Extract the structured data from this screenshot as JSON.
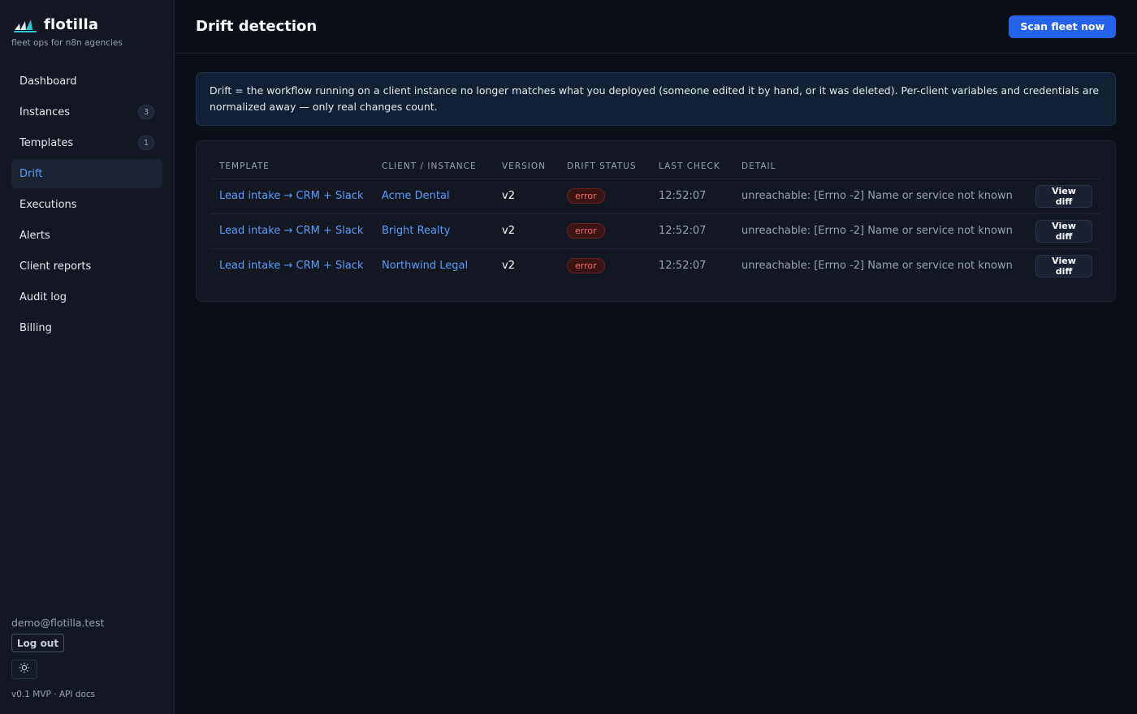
{
  "brand": {
    "name": "flotilla",
    "tagline": "fleet ops for n8n agencies",
    "logo_icon": "sailboats-logo-icon",
    "accent": "#2ec4d6"
  },
  "sidebar": {
    "items": [
      {
        "label": "Dashboard",
        "badge": null,
        "active": false
      },
      {
        "label": "Instances",
        "badge": "3",
        "active": false
      },
      {
        "label": "Templates",
        "badge": "1",
        "active": false
      },
      {
        "label": "Drift",
        "badge": null,
        "active": true
      },
      {
        "label": "Executions",
        "badge": null,
        "active": false
      },
      {
        "label": "Alerts",
        "badge": null,
        "active": false
      },
      {
        "label": "Client reports",
        "badge": null,
        "active": false
      },
      {
        "label": "Audit log",
        "badge": null,
        "active": false
      },
      {
        "label": "Billing",
        "badge": null,
        "active": false
      }
    ],
    "footer": {
      "email": "demo@flotilla.test",
      "logout_label": "Log out",
      "theme_icon": "sun-icon",
      "version": "v0.1 MVP",
      "separator": "·",
      "api_docs": "API docs"
    }
  },
  "header": {
    "title": "Drift detection",
    "scan_label": "Scan fleet now"
  },
  "info": {
    "text": "Drift = the workflow running on a client instance no longer matches what you deployed (someone edited it by hand, or it was deleted). Per-client variables and credentials are normalized away — only real changes count."
  },
  "table": {
    "columns": [
      "TEMPLATE",
      "CLIENT / INSTANCE",
      "VERSION",
      "DRIFT STATUS",
      "LAST CHECK",
      "DETAIL"
    ],
    "rows": [
      {
        "template": "Lead intake → CRM + Slack",
        "client": "Acme Dental",
        "version": "v2",
        "status": "error",
        "last_check": "12:52:07",
        "detail": "unreachable: [Errno -2] Name or service not known",
        "action": "View diff"
      },
      {
        "template": "Lead intake → CRM + Slack",
        "client": "Bright Realty",
        "version": "v2",
        "status": "error",
        "last_check": "12:52:07",
        "detail": "unreachable: [Errno -2] Name or service not known",
        "action": "View diff"
      },
      {
        "template": "Lead intake → CRM + Slack",
        "client": "Northwind Legal",
        "version": "v2",
        "status": "error",
        "last_check": "12:52:07",
        "detail": "unreachable: [Errno -2] Name or service not known",
        "action": "View diff"
      }
    ]
  },
  "colors": {
    "primary": "#2563eb",
    "link": "#5b9cf6",
    "error": "#f26b6b"
  }
}
